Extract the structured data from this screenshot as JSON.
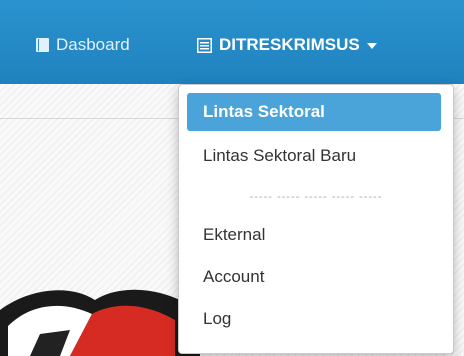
{
  "navbar": {
    "dashboard_label": "Dasboard",
    "dashboard_icon": "book-icon",
    "menu_label": "DITRESKRIMSUS",
    "menu_icon": "list-icon",
    "background_color": "#1f82bd"
  },
  "dropdown": {
    "items": [
      {
        "label": "Lintas Sektoral",
        "active": true
      },
      {
        "label": "Lintas Sektoral Baru",
        "active": false
      },
      {
        "label": "Ekternal",
        "active": false
      },
      {
        "label": "Account",
        "active": false
      },
      {
        "label": "Log",
        "active": false
      }
    ],
    "divider_text": "----- ----- ----- ----- -----",
    "active_color": "#4aa3d9"
  }
}
